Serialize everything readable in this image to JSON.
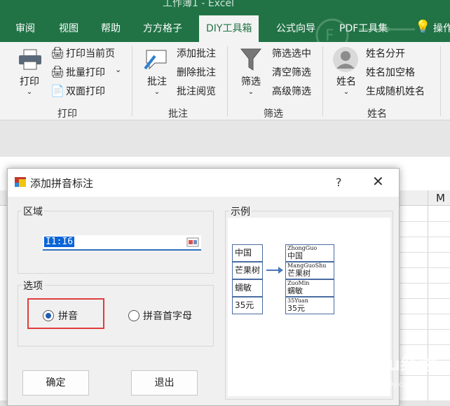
{
  "window": {
    "title": "工作簿1 - Excel"
  },
  "tabs": [
    "审阅",
    "视图",
    "帮助",
    "方方格子",
    "DIY工具箱",
    "公式向导",
    "PDF工具集",
    "操作"
  ],
  "active_tab": "DIY工具箱",
  "ribbon": {
    "print_group": {
      "label": "打印",
      "big_button": "打印",
      "items": [
        "打印当前页",
        "批量打印",
        "双面打印"
      ]
    },
    "comment_group": {
      "label": "批注",
      "big_button": "批注",
      "items": [
        "添加批注",
        "删除批注",
        "批注阅览"
      ]
    },
    "filter_group": {
      "label": "筛选",
      "big_button": "筛选",
      "items": [
        "筛选选中",
        "清空筛选",
        "高级筛选"
      ]
    },
    "name_group": {
      "label": "姓名",
      "big_button": "姓名",
      "items": [
        "姓名分开",
        "姓名加空格",
        "生成随机姓名"
      ]
    }
  },
  "sheet": {
    "column_header": "M"
  },
  "dialog": {
    "title": "添加拼音标注",
    "help": "?",
    "close": "✕",
    "region_legend": "区域",
    "range_value": "I1:I6",
    "options_legend": "选项",
    "option_pinyin": "拼音",
    "option_initials": "拼音首字母",
    "selected_option": "拼音",
    "example_legend": "示例",
    "ok_button": "确定",
    "exit_button": "退出",
    "example": {
      "left": [
        "中国",
        "芒果树",
        "蠕敏",
        "35元"
      ],
      "right": [
        {
          "py": "ZhongGuo",
          "cn": "中国"
        },
        {
          "py": "MangGuoShu",
          "cn": "芒果树"
        },
        {
          "py": "ZuoMin",
          "cn": "蠕敏"
        },
        {
          "py": "35Yuan",
          "cn": "35元"
        }
      ]
    }
  },
  "watermark": {
    "brand": "Baidu经验",
    "url": "jingyan.baidu.com"
  }
}
